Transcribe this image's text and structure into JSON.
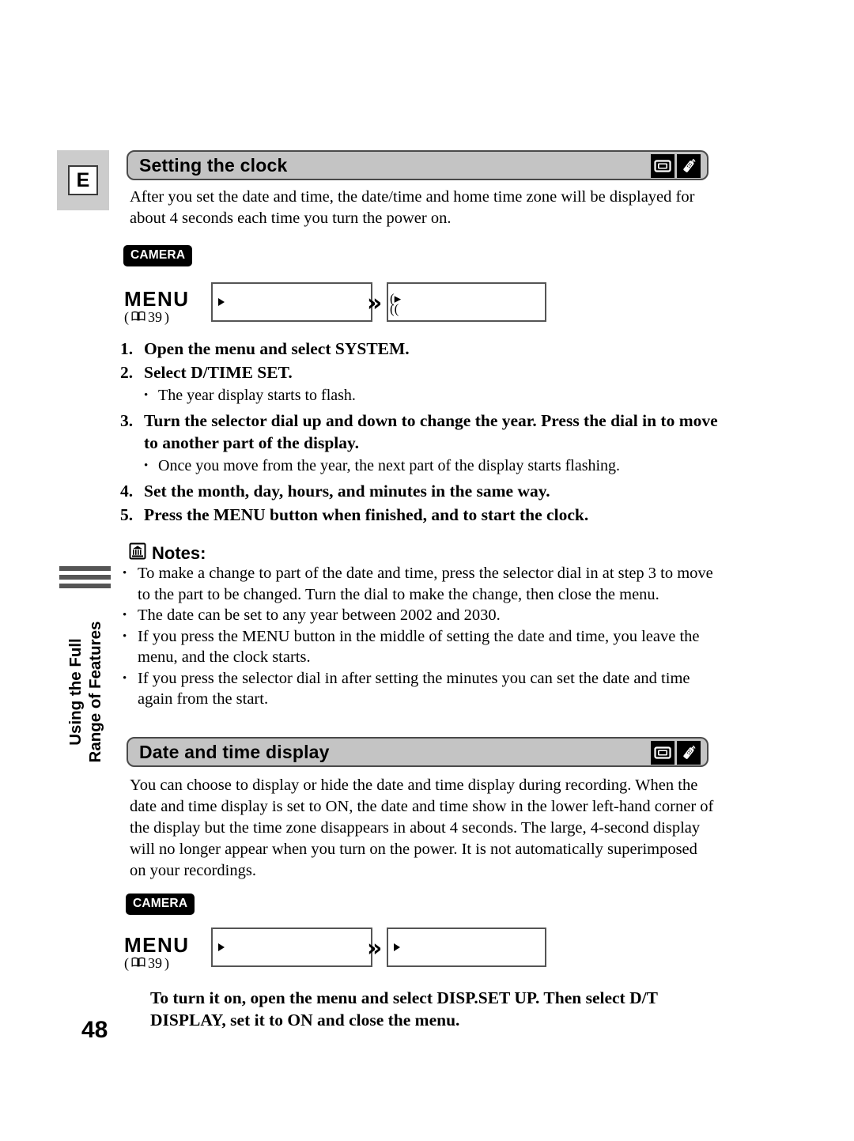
{
  "page": {
    "number": "48",
    "language_tab": "E",
    "running_head_line1": "Using the Full",
    "running_head_line2": "Range of Features"
  },
  "sections": [
    {
      "title": "Setting the clock",
      "icons": [
        "camcorder-icon",
        "remote-control-icon"
      ],
      "intro": "After you set the date and time, the date/time and home time zone will be displayed for about 4 seconds each time you turn the power on.",
      "menu_diagram": {
        "mode_badge": "CAMERA",
        "menu_label": "MENU",
        "page_ref_open": "(",
        "page_ref_num": "39",
        "page_ref_close": ")",
        "box1_text": "",
        "box2_text": "",
        "arrow": "»"
      },
      "steps": [
        {
          "num": "1.",
          "text": "Open the menu and select SYSTEM.",
          "bullets": []
        },
        {
          "num": "2.",
          "text": "Select D/TIME SET.",
          "bullets": [
            "The year display starts to flash."
          ]
        },
        {
          "num": "3.",
          "text": "Turn the selector dial up and down to change the year. Press the dial in to move to another part of the display.",
          "bullets": [
            "Once you move from the year, the next part of the display starts flashing."
          ]
        },
        {
          "num": "4.",
          "text": "Set the month, day, hours, and minutes in the same way.",
          "bullets": []
        },
        {
          "num": "5.",
          "text": "Press the MENU button when finished, and to start the clock.",
          "bullets": []
        }
      ],
      "notes": {
        "heading": "Notes:",
        "icon": "note-memo-icon",
        "items": [
          "To make a change to part of the date and time, press the selector dial in at step 3 to move to the part to be changed. Turn the dial to make the change, then close the menu.",
          "The date can be set to any year between 2002 and 2030.",
          "If you press the MENU button in the middle of setting the date and time, you leave the menu, and the clock starts.",
          "If you press the selector dial in after setting the minutes you can set the date and time again from the start."
        ]
      }
    },
    {
      "title": "Date and time display",
      "icons": [
        "camcorder-icon",
        "remote-control-icon"
      ],
      "intro": "You can choose to display or hide the date and time display during recording. When the date and time display is set to ON, the date and time show in the lower left-hand corner of the display but the time zone disappears in about 4 seconds. The large, 4-second display will no longer appear when you turn on the power. It is not automatically superimposed on your recordings.",
      "menu_diagram": {
        "mode_badge": "CAMERA",
        "menu_label": "MENU",
        "page_ref_open": "(",
        "page_ref_num": "39",
        "page_ref_close": ")",
        "box1_text": "",
        "box2_text": "",
        "arrow": "»"
      },
      "final_instruction": "To turn it on, open the menu and select DISP.SET UP. Then select D/T DISPLAY, set it to ON and close the menu."
    }
  ],
  "colors": {
    "header_bar_fill": "#c4c4c4",
    "header_bar_border": "#4a4a4a",
    "lang_tab_fill": "#cccccc",
    "badge_fill": "#000000",
    "rule_gray": "#555555"
  }
}
